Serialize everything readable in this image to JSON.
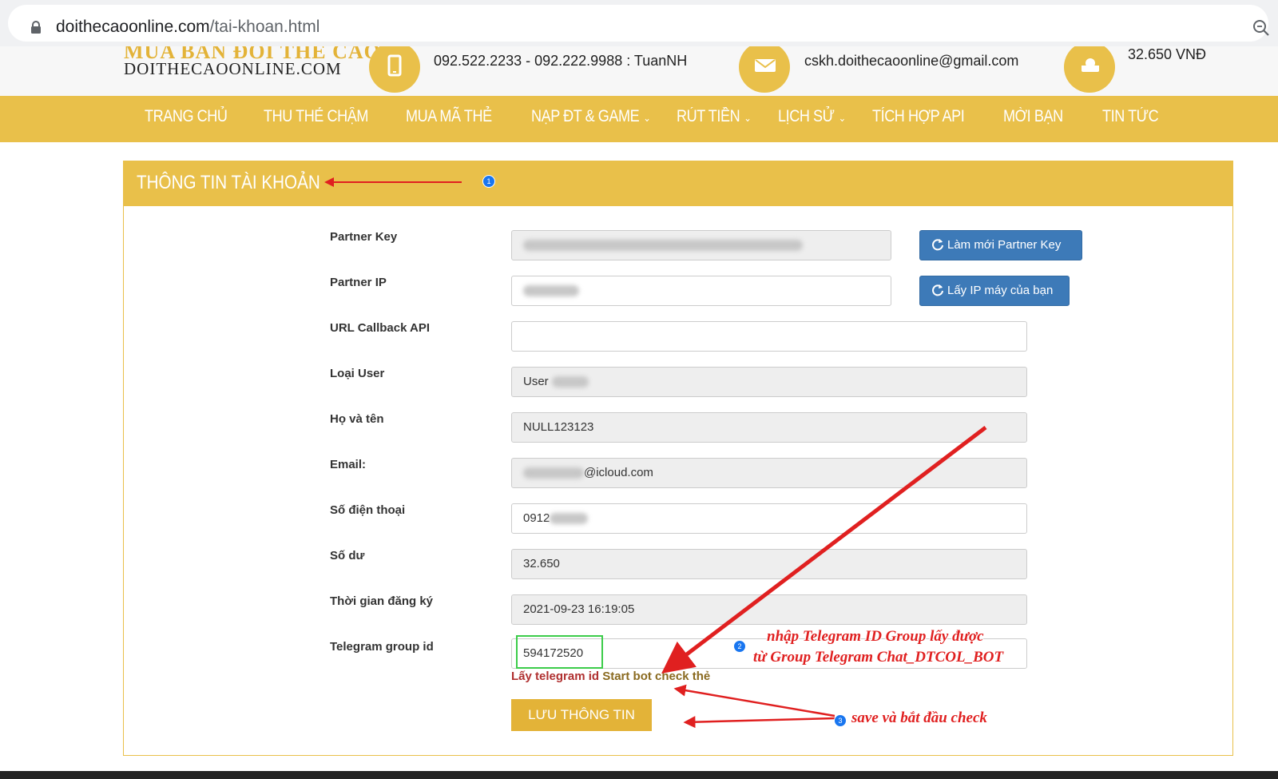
{
  "browser": {
    "url_domain": "doithecaoonline.com",
    "url_path": "/tai-khoan.html"
  },
  "header": {
    "logo_top": "MUA BÁN ĐỔI THẺ CÀO",
    "logo_text": "DOITHECAOONLINE.COM",
    "phone": "092.522.2233 - 092.222.9988 : TuanNH",
    "email": "cskh.doithecaoonline@gmail.com",
    "balance": "32.650 VNĐ"
  },
  "nav": {
    "items": [
      {
        "label": "TRANG CHỦ"
      },
      {
        "label": "THU THẺ CHẬM"
      },
      {
        "label": "MUA MÃ THẺ"
      },
      {
        "label": "NẠP ĐT & GAME",
        "chevron": "⌄"
      },
      {
        "label": "RÚT TIỀN",
        "chevron": "⌄"
      },
      {
        "label": "LỊCH SỬ",
        "chevron": "⌄"
      },
      {
        "label": "TÍCH HỢP API"
      },
      {
        "label": "MỜI BẠN"
      },
      {
        "label": "TIN TỨC"
      }
    ]
  },
  "panel": {
    "title": "THÔNG TIN TÀI KHOẢN"
  },
  "form": {
    "partner_key_label": "Partner Key",
    "partner_ip_label": "Partner IP",
    "url_callback_label": "URL Callback API",
    "url_callback_value": "",
    "user_type_label": "Loại User",
    "user_type_value": "User",
    "fullname_label": "Họ và tên",
    "fullname_value": "NULL123123",
    "email_label": "Email:",
    "email_value": "@icloud.com",
    "phone_label": "Số điện thoại",
    "phone_value": "0912",
    "balance_label": "Số dư",
    "balance_value": "32.650",
    "register_time_label": "Thời gian đăng ký",
    "register_time_value": "2021-09-23 16:19:05",
    "telegram_label": "Telegram group id",
    "telegram_value": "594172520",
    "telegram_link_get": "Lấy telegram id",
    "telegram_link_start": "Start bot check thẻ",
    "refresh_key_button": "Làm mới Partner Key",
    "get_ip_button": "Lấy IP máy của bạn",
    "save_button": "LƯU THÔNG TIN"
  },
  "annotations": {
    "badge_1": "1",
    "badge_2": "2",
    "badge_3": "3",
    "note_2_line1": "nhập Telegram ID Group lấy được",
    "note_2_line2": "từ Group Telegram Chat_DTCOL_BOT",
    "note_3": "save và bắt đầu check"
  },
  "colors": {
    "brand_yellow": "#e9c04a",
    "button_blue": "#3d7ab8",
    "annotation_red": "#e02020"
  }
}
